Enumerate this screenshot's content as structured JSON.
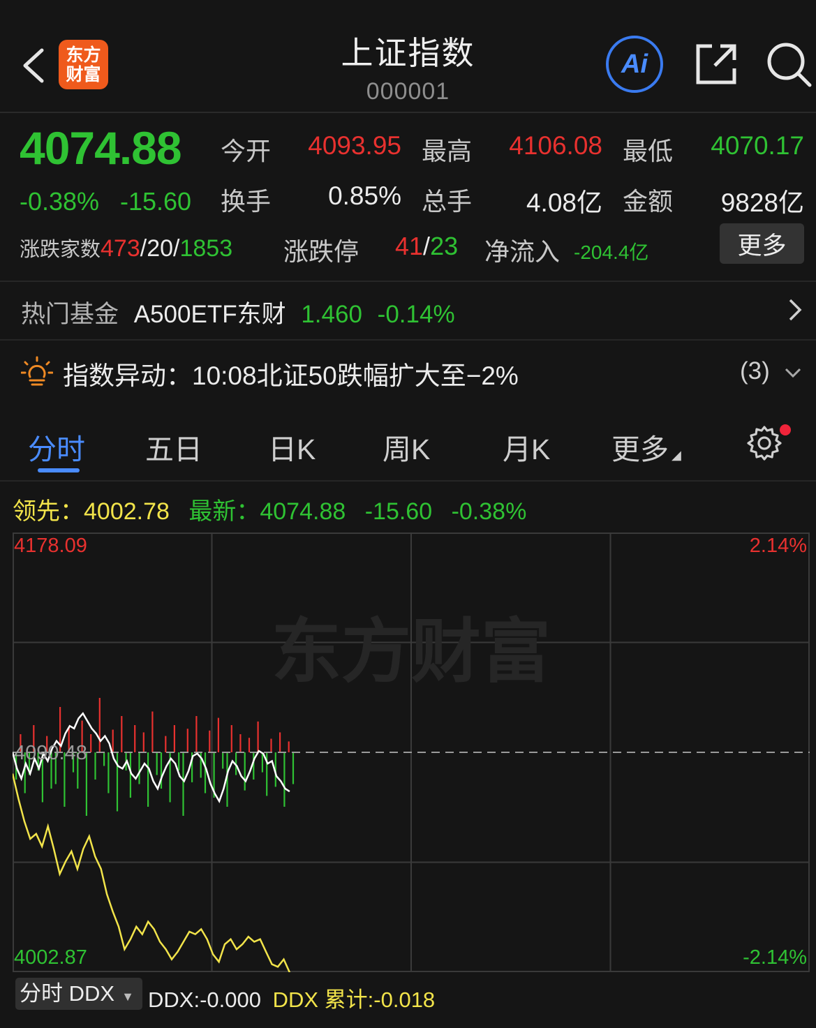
{
  "header": {
    "title": "上证指数",
    "code": "000001",
    "logo_text_line1": "东方",
    "logo_text_line2": "财富",
    "ai_label": "Ai"
  },
  "quote": {
    "price": "4074.88",
    "change_pct": "-0.38%",
    "change": "-15.60",
    "open_label": "今开",
    "open": "4093.95",
    "high_label": "最高",
    "high": "4106.08",
    "low_label": "最低",
    "low": "4070.17",
    "turnover_label": "换手",
    "turnover": "0.85%",
    "volume_label": "总手",
    "volume": "4.08亿",
    "amount_label": "金额",
    "amount": "9828亿",
    "breadth_label": "涨跌家数",
    "breadth_up": "473",
    "breadth_sep1": "/",
    "breadth_flat": "20",
    "breadth_sep2": "/",
    "breadth_down": "1853",
    "limit_label": "涨跌停",
    "limit_up": "41",
    "limit_sep": "/",
    "limit_down": "23",
    "netflow_label": "净流入",
    "netflow": "-204.4亿",
    "more_label": "更多"
  },
  "fund": {
    "label": "热门基金",
    "name": "A500ETF东财",
    "price": "1.460",
    "pct": "-0.14%"
  },
  "alert": {
    "label": "指数异动：",
    "text": "10:08北证50跌幅扩大至−2%",
    "count": "(3)"
  },
  "tabs": [
    "分时",
    "五日",
    "日K",
    "周K",
    "月K",
    "更多"
  ],
  "legend": {
    "lead_label": "领先：",
    "lead_value": "4002.78",
    "latest_label": "最新：",
    "latest_value": "4074.88",
    "change": "-15.60",
    "pct": "-0.38%"
  },
  "chart_data": {
    "type": "line",
    "y_top_label": "4178.09",
    "y_mid_label": "4090.48",
    "y_bottom_label": "4002.87",
    "pct_top_label": "2.14%",
    "pct_bottom_label": "-2.14%",
    "watermark": "东方财富",
    "ylim": [
      4002.87,
      4178.09
    ],
    "prev_close": 4090.48,
    "series": [
      {
        "name": "最新",
        "color": "#ffffff",
        "values": [
          4090.5,
          4084,
          4080,
          4086,
          4082,
          4088,
          4084,
          4090,
          4087,
          4092,
          4095,
          4093,
          4098,
          4101,
          4100,
          4104,
          4106,
          4103,
          4100,
          4098,
          4095,
          4097,
          4094,
          4088,
          4085,
          4084,
          4087,
          4082,
          4080,
          4083,
          4086,
          4084,
          4079,
          4076,
          4081,
          4085,
          4088,
          4086,
          4081,
          4079,
          4083,
          4089,
          4090,
          4088,
          4084,
          4078,
          4074,
          4071,
          4076,
          4083,
          4087,
          4085,
          4081,
          4079,
          4083,
          4088,
          4091,
          4090,
          4086,
          4087,
          4081,
          4079,
          4076,
          4074.88
        ]
      },
      {
        "name": "领先",
        "color": "#f2e44a",
        "values": [
          4082,
          4072,
          4063,
          4056,
          4058,
          4053,
          4061,
          4052,
          4042,
          4047,
          4051,
          4044,
          4052,
          4057,
          4049,
          4044,
          4034,
          4027,
          4021,
          4012,
          4016,
          4021,
          4018,
          4023,
          4020,
          4015,
          4012,
          4008,
          4011,
          4015,
          4019,
          4018,
          4020,
          4016,
          4010,
          4007,
          4014,
          4016,
          4012,
          4014,
          4017,
          4015,
          4016,
          4011,
          4006,
          4005,
          4008,
          4002.78
        ]
      }
    ],
    "volume_bars": {
      "up_color": "#e8312f",
      "down_color": "#2fc233",
      "values": [
        -30,
        20,
        -45,
        -25,
        30,
        -20,
        -55,
        18,
        -40,
        -35,
        50,
        -60,
        28,
        -22,
        -40,
        35,
        -70,
        20,
        -30,
        60,
        -15,
        -45,
        25,
        -65,
        40,
        -20,
        -50,
        30,
        -35,
        22,
        -60,
        45,
        -25,
        -40,
        18,
        -55,
        30,
        -20,
        -70,
        26,
        -33,
        40,
        -28,
        -45,
        24,
        -50,
        38,
        -18,
        -60,
        30,
        -25,
        20,
        -42,
        16,
        -30,
        34,
        -22,
        -48,
        15,
        -38,
        22,
        -60,
        12,
        -35
      ]
    }
  },
  "ddx": {
    "select_label": "分时 DDX",
    "ddx_label": "DDX:-0.000",
    "ddx_cum_label": "DDX 累计:-0.018"
  }
}
